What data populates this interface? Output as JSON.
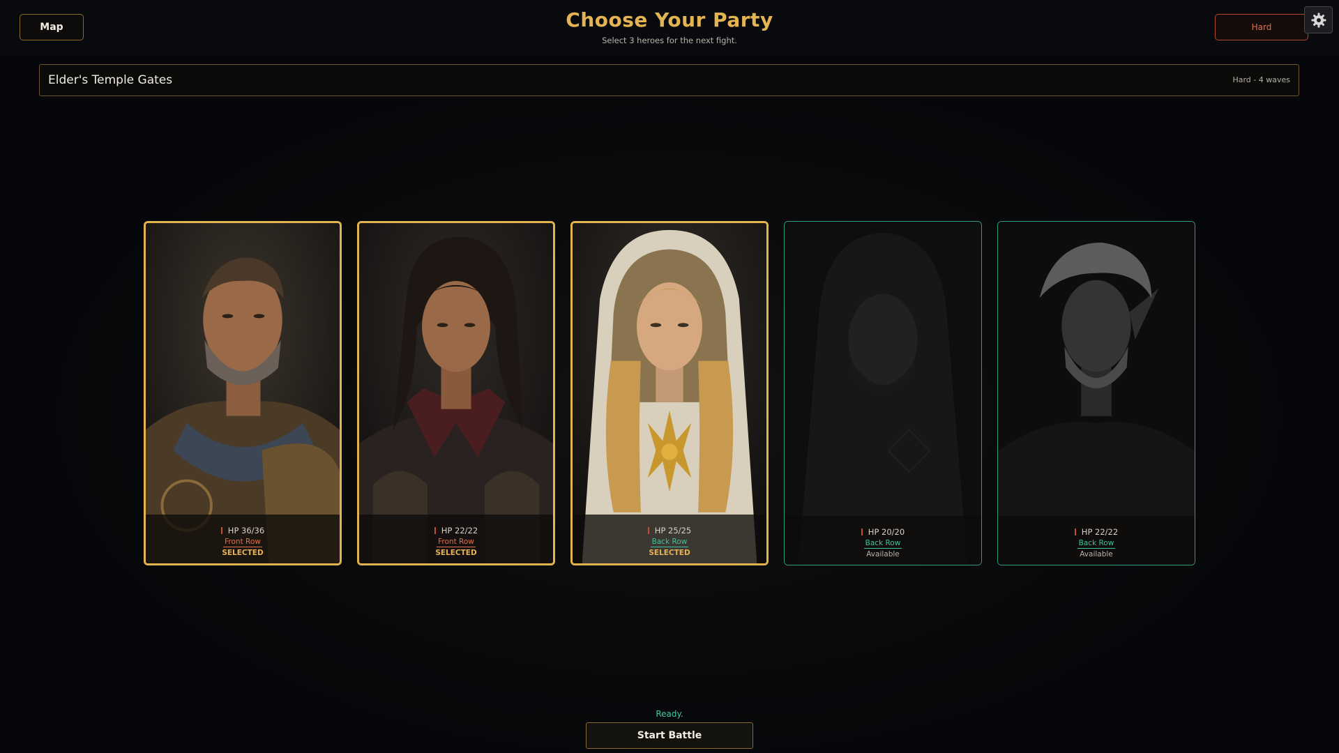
{
  "header": {
    "map_label": "Map",
    "title": "Choose Your Party",
    "subtitle": "Select 3 heroes for the next fight.",
    "difficulty_label": "Hard",
    "settings_icon": "gear-icon"
  },
  "level": {
    "name": "Elder's Temple Gates",
    "meta": "Hard - 4 waves"
  },
  "heroes": [
    {
      "hp": "HP 36/36",
      "row": "Front Row",
      "status": "SELECTED",
      "selected": true
    },
    {
      "hp": "HP 22/22",
      "row": "Front Row",
      "status": "SELECTED",
      "selected": true
    },
    {
      "hp": "HP 25/25",
      "row": "Back Row",
      "status": "SELECTED",
      "selected": true
    },
    {
      "hp": "HP 20/20",
      "row": "Back Row",
      "status": "Available",
      "selected": false
    },
    {
      "hp": "HP 22/22",
      "row": "Back Row",
      "status": "Available",
      "selected": false
    }
  ],
  "footer": {
    "status_text": "Ready.",
    "start_label": "Start Battle"
  },
  "colors": {
    "accent_gold": "#e3b34d",
    "available_teal": "#2f9b80",
    "front_row": "#e0704e",
    "back_row": "#3fc3a0",
    "difficulty_hard": "#b04a2c"
  }
}
